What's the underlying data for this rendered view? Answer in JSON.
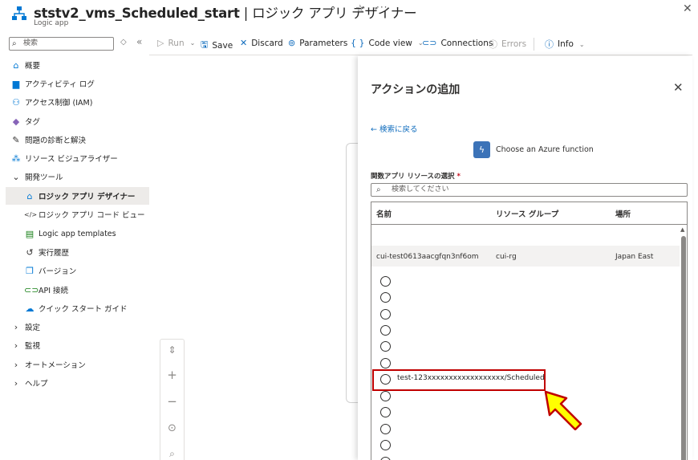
{
  "header": {
    "title_bold": "ststv2_vms_Scheduled_start",
    "title_rest": " | ロジック アプリ デザイナー",
    "subtitle": "Logic app",
    "star_icon": "★",
    "more_icon": "···",
    "close_icon": "✕"
  },
  "sidebar": {
    "search_placeholder": "検索",
    "collapse_icons": [
      "◇",
      "«"
    ],
    "items": [
      {
        "label": "概要",
        "icon": "overview-icon",
        "glyph": "⌂",
        "color": "#0078d4"
      },
      {
        "label": "アクティビティ ログ",
        "icon": "activity-log-icon",
        "glyph": "▆",
        "color": "#0078d4"
      },
      {
        "label": "アクセス制御 (IAM)",
        "icon": "iam-icon",
        "glyph": "⚇",
        "color": "#0078d4"
      },
      {
        "label": "タグ",
        "icon": "tag-icon",
        "glyph": "◆",
        "color": "#8764b8"
      },
      {
        "label": "問題の診断と解決",
        "icon": "wrench-icon",
        "glyph": "✎",
        "color": "#323130"
      },
      {
        "label": "リソース ビジュアライザー",
        "icon": "visualizer-icon",
        "glyph": "⁂",
        "color": "#0078d4"
      },
      {
        "label": "開発ツール",
        "icon": "chevron-down-icon",
        "glyph": "⌄",
        "color": "#323130"
      },
      {
        "label": "ロジック アプリ デザイナー",
        "icon": "designer-icon",
        "glyph": "⌂",
        "color": "#0078d4",
        "selected": true
      },
      {
        "label": "ロジック アプリ コード ビュー",
        "icon": "code-icon",
        "glyph": "</>",
        "color": "#323130"
      },
      {
        "label": "Logic app templates",
        "icon": "templates-icon",
        "glyph": "▤",
        "color": "#107c10"
      },
      {
        "label": "実行履歴",
        "icon": "history-icon",
        "glyph": "↺",
        "color": "#323130"
      },
      {
        "label": "バージョン",
        "icon": "version-icon",
        "glyph": "❐",
        "color": "#0078d4"
      },
      {
        "label": "API 接続",
        "icon": "api-connection-icon",
        "glyph": "⊂⊃",
        "color": "#107c10"
      },
      {
        "label": "クイック スタート ガイド",
        "icon": "quickstart-icon",
        "glyph": "☁",
        "color": "#0078d4"
      },
      {
        "label": "設定",
        "icon": "chevron-right-icon",
        "glyph": "›",
        "color": "#323130"
      },
      {
        "label": "監視",
        "icon": "chevron-right-icon",
        "glyph": "›",
        "color": "#323130"
      },
      {
        "label": "オートメーション",
        "icon": "chevron-right-icon",
        "glyph": "›",
        "color": "#323130"
      },
      {
        "label": "ヘルプ",
        "icon": "chevron-right-icon",
        "glyph": "›",
        "color": "#323130"
      }
    ]
  },
  "toolbar": {
    "run": "Run",
    "save": "Save",
    "discard": "Discard",
    "parameters": "Parameters",
    "code_view": "Code view",
    "connections": "Connections",
    "errors": "Errors",
    "info": "Info"
  },
  "zoom": {
    "fit_icon": "⇕",
    "zoom_in_icon": "+",
    "zoom_out_icon": "−",
    "center_icon": "⊙",
    "search_icon": "⌕"
  },
  "panel": {
    "title": "アクションの追加",
    "close_icon": "✕",
    "back_link": "← 検索に戻る",
    "function_icon": "ϟ",
    "function_label": "Choose an Azure function",
    "field_label": "関数アプリ リソースの選択",
    "required_mark": "*",
    "search_placeholder": "検索してください",
    "columns": [
      "名前",
      "リソース グループ",
      "場所"
    ],
    "row": {
      "name": "cui-test0613aacgfqn3nf6om",
      "group": "cui-rg",
      "location": "Japan East"
    },
    "selected_function": "test-123xxxxxxxxxxxxxxxxxx/Scheduled",
    "scroll_up_icon": "▲"
  },
  "annotation": {
    "box_color": "#c00000",
    "arrow_fill": "#ffff00",
    "arrow_stroke": "#c00000"
  }
}
